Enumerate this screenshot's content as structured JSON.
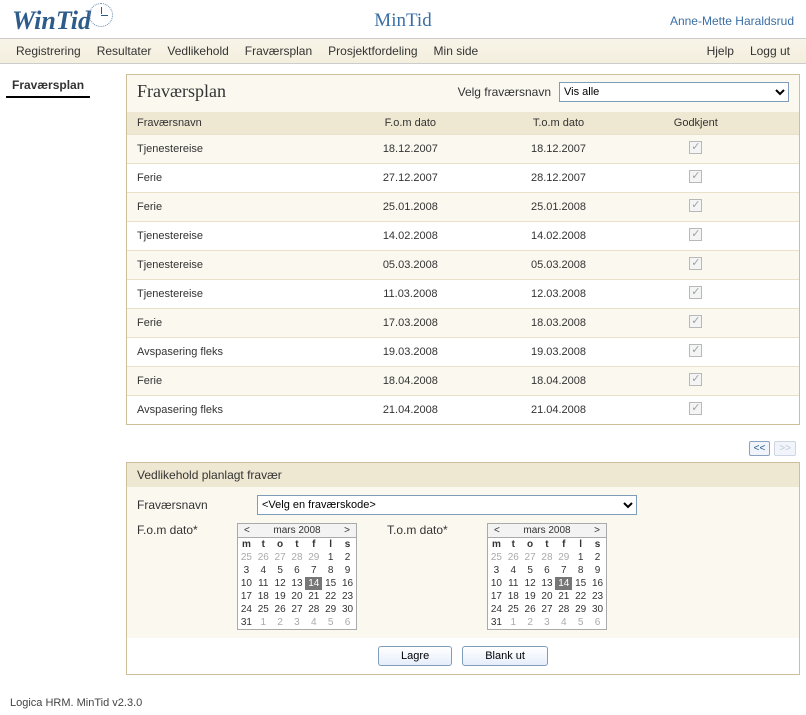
{
  "header": {
    "logo_text": "WinTid",
    "app_title": "MinTid",
    "user": "Anne-Mette Haraldsrud"
  },
  "menu": {
    "items": [
      "Registrering",
      "Resultater",
      "Vedlikehold",
      "Fraværsplan",
      "Prosjektfordeling",
      "Min side"
    ],
    "right": [
      "Hjelp",
      "Logg ut"
    ]
  },
  "sidebar": {
    "item": "Fraværsplan"
  },
  "panel": {
    "title": "Fraværsplan",
    "filter_label": "Velg fraværsnavn",
    "filter_selected": "Vis alle",
    "columns": {
      "name": "Fraværsnavn",
      "from": "F.o.m dato",
      "to": "T.o.m dato",
      "approved": "Godkjent"
    },
    "rows": [
      {
        "name": "Tjenestereise",
        "from": "18.12.2007",
        "to": "18.12.2007",
        "approved": true
      },
      {
        "name": "Ferie",
        "from": "27.12.2007",
        "to": "28.12.2007",
        "approved": true
      },
      {
        "name": "Ferie",
        "from": "25.01.2008",
        "to": "25.01.2008",
        "approved": true
      },
      {
        "name": "Tjenestereise",
        "from": "14.02.2008",
        "to": "14.02.2008",
        "approved": true
      },
      {
        "name": "Tjenestereise",
        "from": "05.03.2008",
        "to": "05.03.2008",
        "approved": true
      },
      {
        "name": "Tjenestereise",
        "from": "11.03.2008",
        "to": "12.03.2008",
        "approved": true
      },
      {
        "name": "Ferie",
        "from": "17.03.2008",
        "to": "18.03.2008",
        "approved": true
      },
      {
        "name": "Avspasering fleks",
        "from": "19.03.2008",
        "to": "19.03.2008",
        "approved": true
      },
      {
        "name": "Ferie",
        "from": "18.04.2008",
        "to": "18.04.2008",
        "approved": true
      },
      {
        "name": "Avspasering fleks",
        "from": "21.04.2008",
        "to": "21.04.2008",
        "approved": true
      }
    ],
    "pager": {
      "prev": "<<",
      "next": ">>"
    }
  },
  "form": {
    "heading": "Vedlikehold planlagt fravær",
    "name_label": "Fraværsnavn",
    "name_placeholder": "<Velg en fraværskode>",
    "from_label": "F.o.m dato*",
    "to_label": "T.o.m dato*",
    "calendar": {
      "prev": "<",
      "next": ">",
      "month": "mars 2008",
      "dow": [
        "m",
        "t",
        "o",
        "t",
        "f",
        "l",
        "s"
      ],
      "weeks": [
        [
          {
            "d": 25,
            "dim": true
          },
          {
            "d": 26,
            "dim": true
          },
          {
            "d": 27,
            "dim": true
          },
          {
            "d": 28,
            "dim": true
          },
          {
            "d": 29,
            "dim": true
          },
          {
            "d": 1
          },
          {
            "d": 2
          }
        ],
        [
          {
            "d": 3
          },
          {
            "d": 4
          },
          {
            "d": 5
          },
          {
            "d": 6
          },
          {
            "d": 7
          },
          {
            "d": 8
          },
          {
            "d": 9
          }
        ],
        [
          {
            "d": 10
          },
          {
            "d": 11
          },
          {
            "d": 12
          },
          {
            "d": 13
          },
          {
            "d": 14,
            "sel": true
          },
          {
            "d": 15
          },
          {
            "d": 16
          }
        ],
        [
          {
            "d": 17
          },
          {
            "d": 18
          },
          {
            "d": 19
          },
          {
            "d": 20
          },
          {
            "d": 21
          },
          {
            "d": 22
          },
          {
            "d": 23
          }
        ],
        [
          {
            "d": 24
          },
          {
            "d": 25
          },
          {
            "d": 26
          },
          {
            "d": 27
          },
          {
            "d": 28
          },
          {
            "d": 29
          },
          {
            "d": 30
          }
        ],
        [
          {
            "d": 31
          },
          {
            "d": 1,
            "dim": true
          },
          {
            "d": 2,
            "dim": true
          },
          {
            "d": 3,
            "dim": true
          },
          {
            "d": 4,
            "dim": true
          },
          {
            "d": 5,
            "dim": true
          },
          {
            "d": 6,
            "dim": true
          }
        ]
      ]
    },
    "save": "Lagre",
    "clear": "Blank ut"
  },
  "footer": "Logica HRM. MinTid v2.3.0"
}
